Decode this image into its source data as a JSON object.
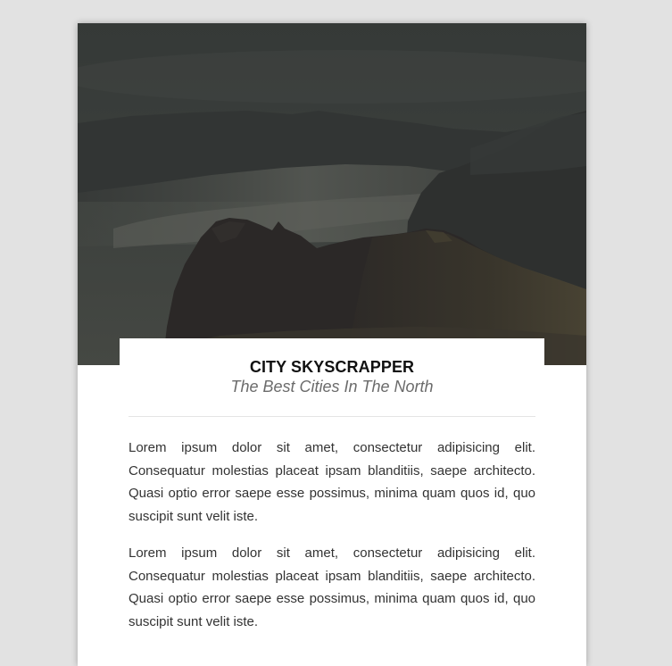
{
  "card": {
    "title": "CITY SKYSCRAPPER",
    "subtitle": "The Best Cities In The North",
    "paragraphs": [
      "Lorem ipsum dolor sit amet, consectetur adipisicing elit. Consequatur molestias placeat ipsam blanditiis, saepe architecto. Quasi optio error saepe esse possimus, minima quam quos id, quo suscipit sunt velit iste.",
      "Lorem ipsum dolor sit amet, consectetur adipisicing elit. Consequatur molestias placeat ipsam blanditiis, saepe architecto. Quasi optio error saepe esse possimus, minima quam quos id, quo suscipit sunt velit iste."
    ]
  },
  "colors": {
    "page_background": "#e2e2e2",
    "card_background": "#ffffff",
    "title_text": "#111111",
    "subtitle_text": "#6b6b6b",
    "body_text": "#333333"
  }
}
